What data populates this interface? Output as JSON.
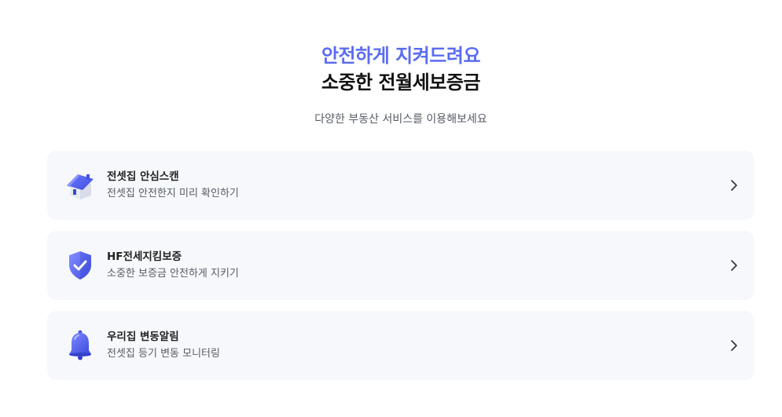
{
  "hero": {
    "accent": "안전하게 지켜드려요",
    "title": "소중한 전월세보증금",
    "subtitle": "다양한 부동산 서비스를 이용해보세요"
  },
  "services": [
    {
      "icon": "house-icon",
      "title": "전셋집 안심스캔",
      "description": "전셋집 안전한지 미리 확인하기"
    },
    {
      "icon": "shield-check-icon",
      "title": "HF전세지킴보증",
      "description": "소중한 보증금 안전하게 지키기"
    },
    {
      "icon": "bell-icon",
      "title": "우리집 변동알림",
      "description": "전셋집 등기 변동 모니터링"
    }
  ],
  "colors": {
    "accent": "#5b6cf0",
    "card_background": "#f7f8fb",
    "icon_primary": "#4f5ef0"
  }
}
